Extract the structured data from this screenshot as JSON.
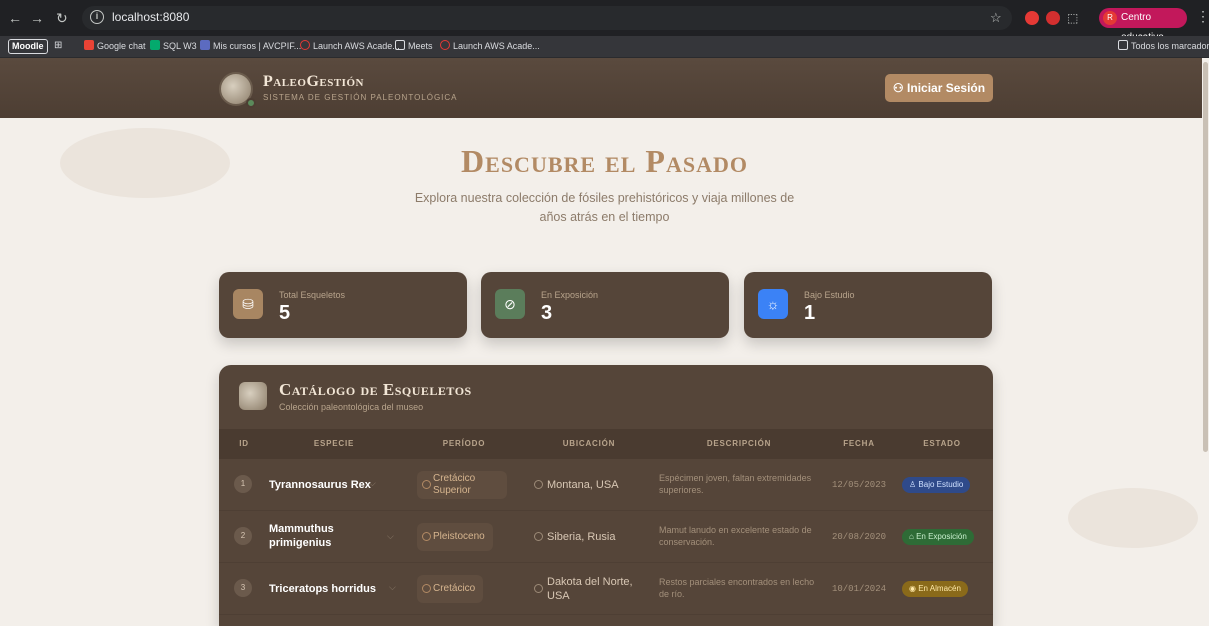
{
  "browser": {
    "url": "localhost:8080",
    "profile": "Centro educativo",
    "profile_initial": "R",
    "bookmarks": [
      "Moodle",
      "Google chat",
      "SQL W3",
      "Mis cursos | AVCPIF...",
      "Launch AWS Acade...",
      "Meets",
      "Launch AWS Acade..."
    ],
    "all_bookmarks": "Todos los marcadores"
  },
  "header": {
    "title": "PaleoGestión",
    "subtitle": "Sistema de Gestión Paleontológica",
    "login_label": "Iniciar Sesión"
  },
  "hero": {
    "title": "Descubre el Pasado",
    "subtitle": "Explora nuestra colección de fósiles prehistóricos y viaja millones de años atrás en el tiempo"
  },
  "stats": [
    {
      "label": "Total Esqueletos",
      "value": "5",
      "color": "#a88662"
    },
    {
      "label": "En Exposición",
      "value": "3",
      "color": "#5b7d5b"
    },
    {
      "label": "Bajo Estudio",
      "value": "1",
      "color": "#3b82f6"
    }
  ],
  "catalog": {
    "title": "Catálogo de Esqueletos",
    "subtitle": "Colección paleontológica del museo",
    "columns": [
      "ID",
      "Especie",
      "Período",
      "Ubicación",
      "Descripción",
      "Fecha",
      "Estado"
    ],
    "rows": [
      {
        "id": "1",
        "species": "Tyrannosaurus Rex",
        "period": "Cretácico Superior",
        "location": "Montana, USA",
        "description": "Espécimen joven, faltan extremidades superiores.",
        "date": "12/05/2023",
        "status": "Bajo Estudio",
        "status_icon": "♙",
        "status_bg": "#2f4a8a",
        "status_fg": "#cfe0ff"
      },
      {
        "id": "2",
        "species": "Mammuthus primigenius",
        "period": "Pleistoceno",
        "location": "Siberia, Rusia",
        "description": "Mamut lanudo en excelente estado de conservación.",
        "date": "20/08/2020",
        "status": "En Exposición",
        "status_icon": "⌂",
        "status_bg": "#2e6b36",
        "status_fg": "#c9f0cf"
      },
      {
        "id": "3",
        "species": "Triceratops horridus",
        "period": "Cretácico",
        "location": "Dakota del Norte, USA",
        "description": "Restos parciales encontrados en lecho de río.",
        "date": "10/01/2024",
        "status": "En Almacén",
        "status_icon": "◉",
        "status_bg": "#8a6a1a",
        "status_fg": "#ffe9a8"
      }
    ]
  }
}
